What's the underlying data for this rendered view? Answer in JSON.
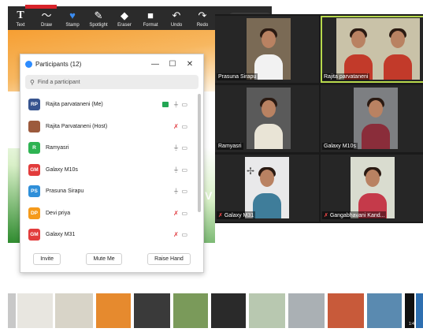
{
  "toolbar": {
    "tools": [
      {
        "icon": "text-icon",
        "glyph": "T",
        "label": "Text"
      },
      {
        "icon": "draw-icon",
        "glyph": "〜",
        "label": "Draw"
      },
      {
        "icon": "stamp-icon",
        "glyph": "♥",
        "label": "Stamp"
      },
      {
        "icon": "spotlight-icon",
        "glyph": "✎",
        "label": "Spotlight"
      },
      {
        "icon": "eraser-icon",
        "glyph": "◆",
        "label": "Eraser"
      },
      {
        "icon": "format-icon",
        "glyph": "■",
        "label": "Format"
      },
      {
        "icon": "undo-icon",
        "glyph": "↶",
        "label": "Undo"
      },
      {
        "icon": "redo-icon",
        "glyph": "↷",
        "label": "Redo"
      }
    ]
  },
  "participants_panel": {
    "title": "Participants (12)",
    "search_placeholder": "Find a participant",
    "participants": [
      {
        "initials": "RP",
        "color": "#37548f",
        "name": "Rajita parvataneni (Me)",
        "mic": "on",
        "recording": true
      },
      {
        "initials": "",
        "color": "#9c5a3c",
        "name": "Rajita Parvataneni (Host)",
        "mic": "muted",
        "recording": false
      },
      {
        "initials": "R",
        "color": "#2eb352",
        "name": "Ramyasri",
        "mic": "on",
        "recording": false
      },
      {
        "initials": "GM",
        "color": "#e23c3c",
        "name": "Galaxy M10s",
        "mic": "on",
        "recording": false
      },
      {
        "initials": "PS",
        "color": "#2f8fd9",
        "name": "Prasuna Sirapu",
        "mic": "on",
        "recording": false
      },
      {
        "initials": "DP",
        "color": "#f59a1b",
        "name": "Devi priya",
        "mic": "muted",
        "recording": false
      },
      {
        "initials": "GM",
        "color": "#e23c3c",
        "name": "Galaxy M31",
        "mic": "muted",
        "recording": false
      }
    ],
    "footer": {
      "invite": "Invite",
      "mute_me": "Mute Me",
      "raise_hand": "Raise Hand"
    }
  },
  "gallery": {
    "tiles": [
      {
        "name": "Prasuna Sirapu",
        "muted": false,
        "active": false
      },
      {
        "name": "Rajita parvataneni",
        "muted": false,
        "active": true
      },
      {
        "name": "Ramyasri",
        "muted": false,
        "active": false
      },
      {
        "name": "Galaxy M10s",
        "muted": false,
        "active": false
      },
      {
        "name": "Galaxy M31",
        "muted": true,
        "active": false
      },
      {
        "name": "Gangabhavani Kand...",
        "muted": true,
        "active": false
      }
    ]
  },
  "thumbnails": [
    {
      "caption": ""
    },
    {
      "caption": ""
    },
    {
      "caption": ""
    },
    {
      "caption": ""
    },
    {
      "caption": ""
    },
    {
      "caption": ""
    },
    {
      "caption": ""
    },
    {
      "caption": ""
    },
    {
      "caption": ""
    },
    {
      "caption": ""
    },
    {
      "caption": ""
    },
    {
      "caption": "1:43"
    },
    {
      "caption": ""
    }
  ]
}
